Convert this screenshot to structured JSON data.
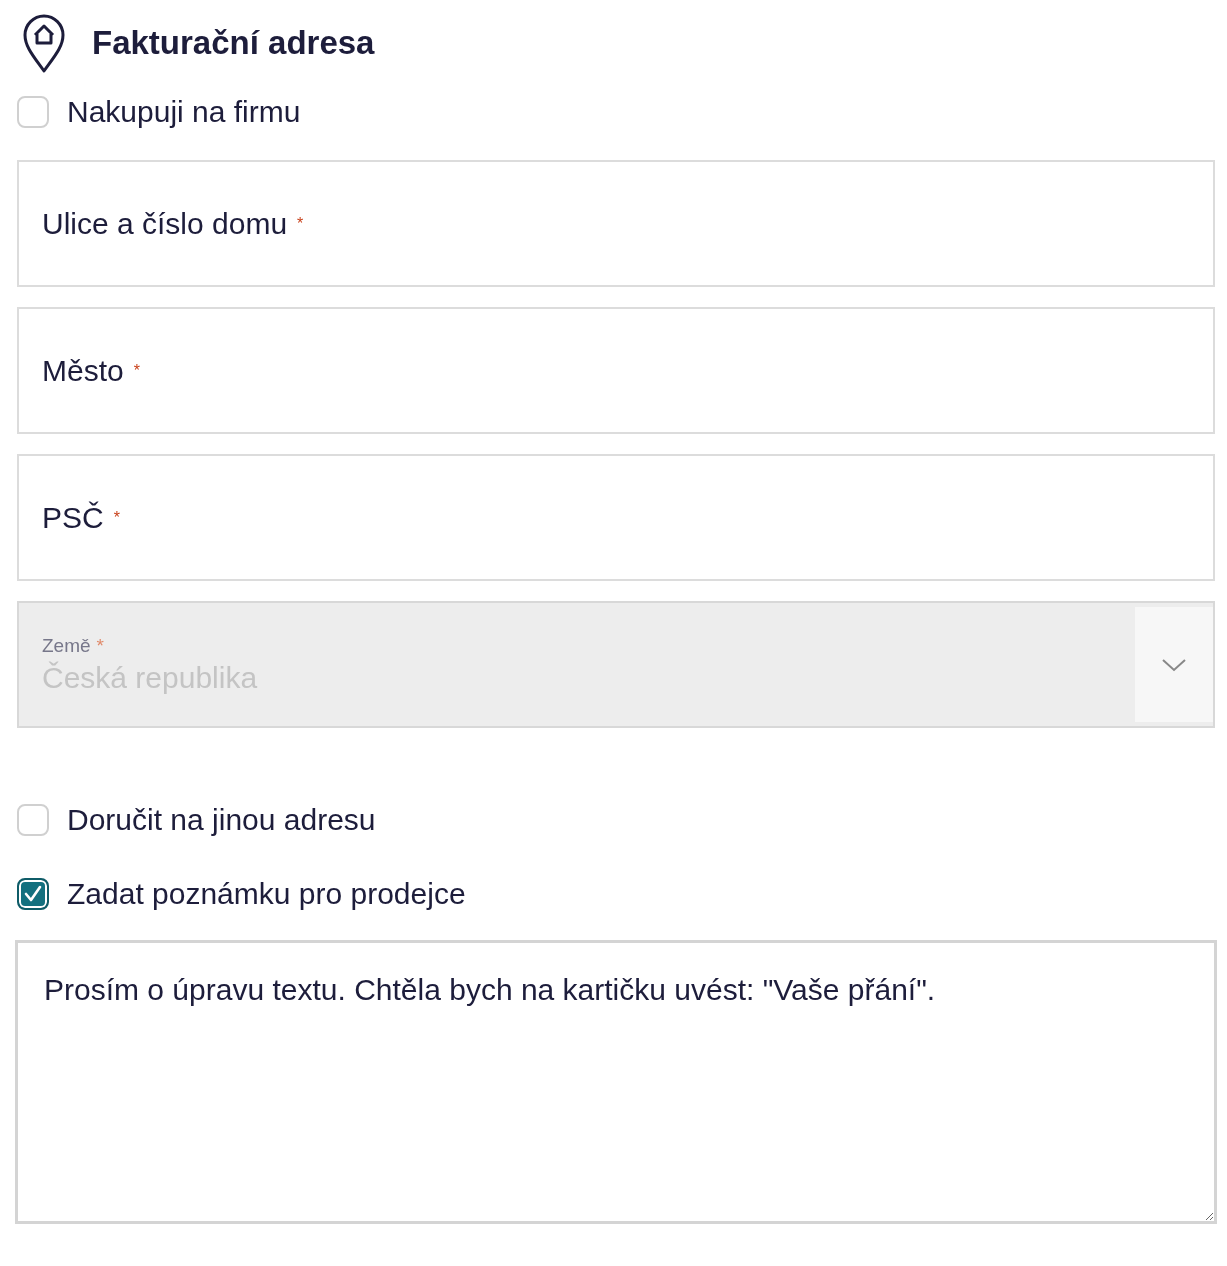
{
  "section": {
    "title": "Fakturační adresa"
  },
  "company_checkbox": {
    "label": "Nakupuji na firmu",
    "checked": false
  },
  "fields": [
    {
      "label": "Ulice a číslo domu",
      "required_mark": "*"
    },
    {
      "label": "Město",
      "required_mark": "*"
    },
    {
      "label": "PSČ",
      "required_mark": "*"
    }
  ],
  "country_select": {
    "label": "Země",
    "required_mark": "*",
    "value": "Česká republika",
    "disabled": true
  },
  "options": [
    {
      "label": "Doručit na jinou adresu",
      "checked": false
    },
    {
      "label": "Zadat poznámku pro prodejce",
      "checked": true
    }
  ],
  "note": {
    "value": "Prosím o úpravu textu. Chtěla bych na kartičku uvést: \"Vaše přání\"."
  }
}
